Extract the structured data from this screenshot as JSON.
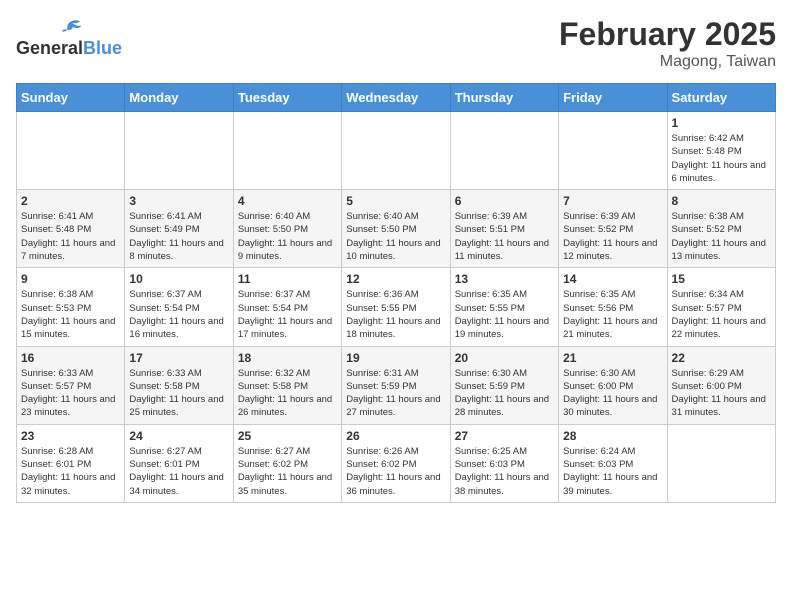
{
  "header": {
    "logo_general": "General",
    "logo_blue": "Blue",
    "main_title": "February 2025",
    "subtitle": "Magong, Taiwan"
  },
  "days_of_week": [
    "Sunday",
    "Monday",
    "Tuesday",
    "Wednesday",
    "Thursday",
    "Friday",
    "Saturday"
  ],
  "weeks": [
    [
      {
        "day": "",
        "info": ""
      },
      {
        "day": "",
        "info": ""
      },
      {
        "day": "",
        "info": ""
      },
      {
        "day": "",
        "info": ""
      },
      {
        "day": "",
        "info": ""
      },
      {
        "day": "",
        "info": ""
      },
      {
        "day": "1",
        "info": "Sunrise: 6:42 AM\nSunset: 5:48 PM\nDaylight: 11 hours and 6 minutes."
      }
    ],
    [
      {
        "day": "2",
        "info": "Sunrise: 6:41 AM\nSunset: 5:48 PM\nDaylight: 11 hours and 7 minutes."
      },
      {
        "day": "3",
        "info": "Sunrise: 6:41 AM\nSunset: 5:49 PM\nDaylight: 11 hours and 8 minutes."
      },
      {
        "day": "4",
        "info": "Sunrise: 6:40 AM\nSunset: 5:50 PM\nDaylight: 11 hours and 9 minutes."
      },
      {
        "day": "5",
        "info": "Sunrise: 6:40 AM\nSunset: 5:50 PM\nDaylight: 11 hours and 10 minutes."
      },
      {
        "day": "6",
        "info": "Sunrise: 6:39 AM\nSunset: 5:51 PM\nDaylight: 11 hours and 11 minutes."
      },
      {
        "day": "7",
        "info": "Sunrise: 6:39 AM\nSunset: 5:52 PM\nDaylight: 11 hours and 12 minutes."
      },
      {
        "day": "8",
        "info": "Sunrise: 6:38 AM\nSunset: 5:52 PM\nDaylight: 11 hours and 13 minutes."
      }
    ],
    [
      {
        "day": "9",
        "info": "Sunrise: 6:38 AM\nSunset: 5:53 PM\nDaylight: 11 hours and 15 minutes."
      },
      {
        "day": "10",
        "info": "Sunrise: 6:37 AM\nSunset: 5:54 PM\nDaylight: 11 hours and 16 minutes."
      },
      {
        "day": "11",
        "info": "Sunrise: 6:37 AM\nSunset: 5:54 PM\nDaylight: 11 hours and 17 minutes."
      },
      {
        "day": "12",
        "info": "Sunrise: 6:36 AM\nSunset: 5:55 PM\nDaylight: 11 hours and 18 minutes."
      },
      {
        "day": "13",
        "info": "Sunrise: 6:35 AM\nSunset: 5:55 PM\nDaylight: 11 hours and 19 minutes."
      },
      {
        "day": "14",
        "info": "Sunrise: 6:35 AM\nSunset: 5:56 PM\nDaylight: 11 hours and 21 minutes."
      },
      {
        "day": "15",
        "info": "Sunrise: 6:34 AM\nSunset: 5:57 PM\nDaylight: 11 hours and 22 minutes."
      }
    ],
    [
      {
        "day": "16",
        "info": "Sunrise: 6:33 AM\nSunset: 5:57 PM\nDaylight: 11 hours and 23 minutes."
      },
      {
        "day": "17",
        "info": "Sunrise: 6:33 AM\nSunset: 5:58 PM\nDaylight: 11 hours and 25 minutes."
      },
      {
        "day": "18",
        "info": "Sunrise: 6:32 AM\nSunset: 5:58 PM\nDaylight: 11 hours and 26 minutes."
      },
      {
        "day": "19",
        "info": "Sunrise: 6:31 AM\nSunset: 5:59 PM\nDaylight: 11 hours and 27 minutes."
      },
      {
        "day": "20",
        "info": "Sunrise: 6:30 AM\nSunset: 5:59 PM\nDaylight: 11 hours and 28 minutes."
      },
      {
        "day": "21",
        "info": "Sunrise: 6:30 AM\nSunset: 6:00 PM\nDaylight: 11 hours and 30 minutes."
      },
      {
        "day": "22",
        "info": "Sunrise: 6:29 AM\nSunset: 6:00 PM\nDaylight: 11 hours and 31 minutes."
      }
    ],
    [
      {
        "day": "23",
        "info": "Sunrise: 6:28 AM\nSunset: 6:01 PM\nDaylight: 11 hours and 32 minutes."
      },
      {
        "day": "24",
        "info": "Sunrise: 6:27 AM\nSunset: 6:01 PM\nDaylight: 11 hours and 34 minutes."
      },
      {
        "day": "25",
        "info": "Sunrise: 6:27 AM\nSunset: 6:02 PM\nDaylight: 11 hours and 35 minutes."
      },
      {
        "day": "26",
        "info": "Sunrise: 6:26 AM\nSunset: 6:02 PM\nDaylight: 11 hours and 36 minutes."
      },
      {
        "day": "27",
        "info": "Sunrise: 6:25 AM\nSunset: 6:03 PM\nDaylight: 11 hours and 38 minutes."
      },
      {
        "day": "28",
        "info": "Sunrise: 6:24 AM\nSunset: 6:03 PM\nDaylight: 11 hours and 39 minutes."
      },
      {
        "day": "",
        "info": ""
      }
    ]
  ]
}
